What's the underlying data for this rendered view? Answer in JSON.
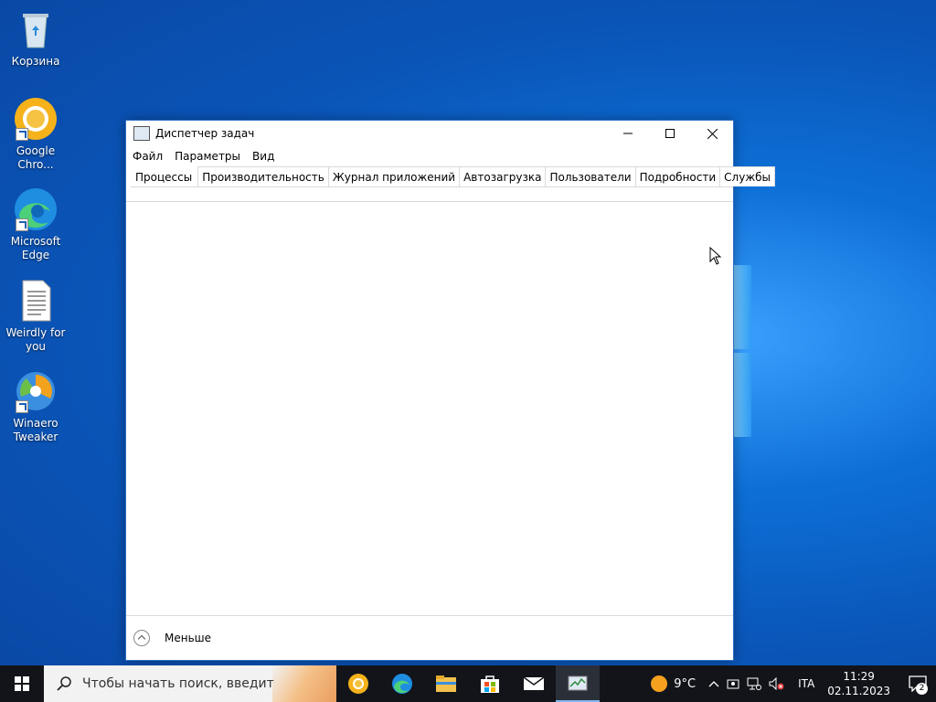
{
  "desktop": {
    "icons": [
      {
        "label_line1": "Корзина",
        "label_line2": ""
      },
      {
        "label_line1": "Google",
        "label_line2": "Chro..."
      },
      {
        "label_line1": "Microsoft",
        "label_line2": "Edge"
      },
      {
        "label_line1": "Weirdly for",
        "label_line2": "you"
      },
      {
        "label_line1": "Winaero",
        "label_line2": "Tweaker"
      }
    ]
  },
  "window": {
    "title": "Диспетчер задач",
    "menu": [
      "Файл",
      "Параметры",
      "Вид"
    ],
    "tabs": [
      "Процессы",
      "Производительность",
      "Журнал приложений",
      "Автозагрузка",
      "Пользователи",
      "Подробности",
      "Службы"
    ],
    "active_tab": "Процессы",
    "footer_label": "Меньше"
  },
  "taskbar": {
    "search_placeholder": "Чтобы начать поиск, введит",
    "weather_temp": "9°C",
    "language": "ITA",
    "time": "11:29",
    "date": "02.11.2023",
    "notification_count": "2",
    "apps": [
      "chrome-icon",
      "edge-icon",
      "file-explorer-icon",
      "store-icon",
      "mail-icon",
      "task-manager-icon"
    ]
  },
  "colors": {
    "accent": "#2b6cc4",
    "taskbar": "#12141a"
  }
}
